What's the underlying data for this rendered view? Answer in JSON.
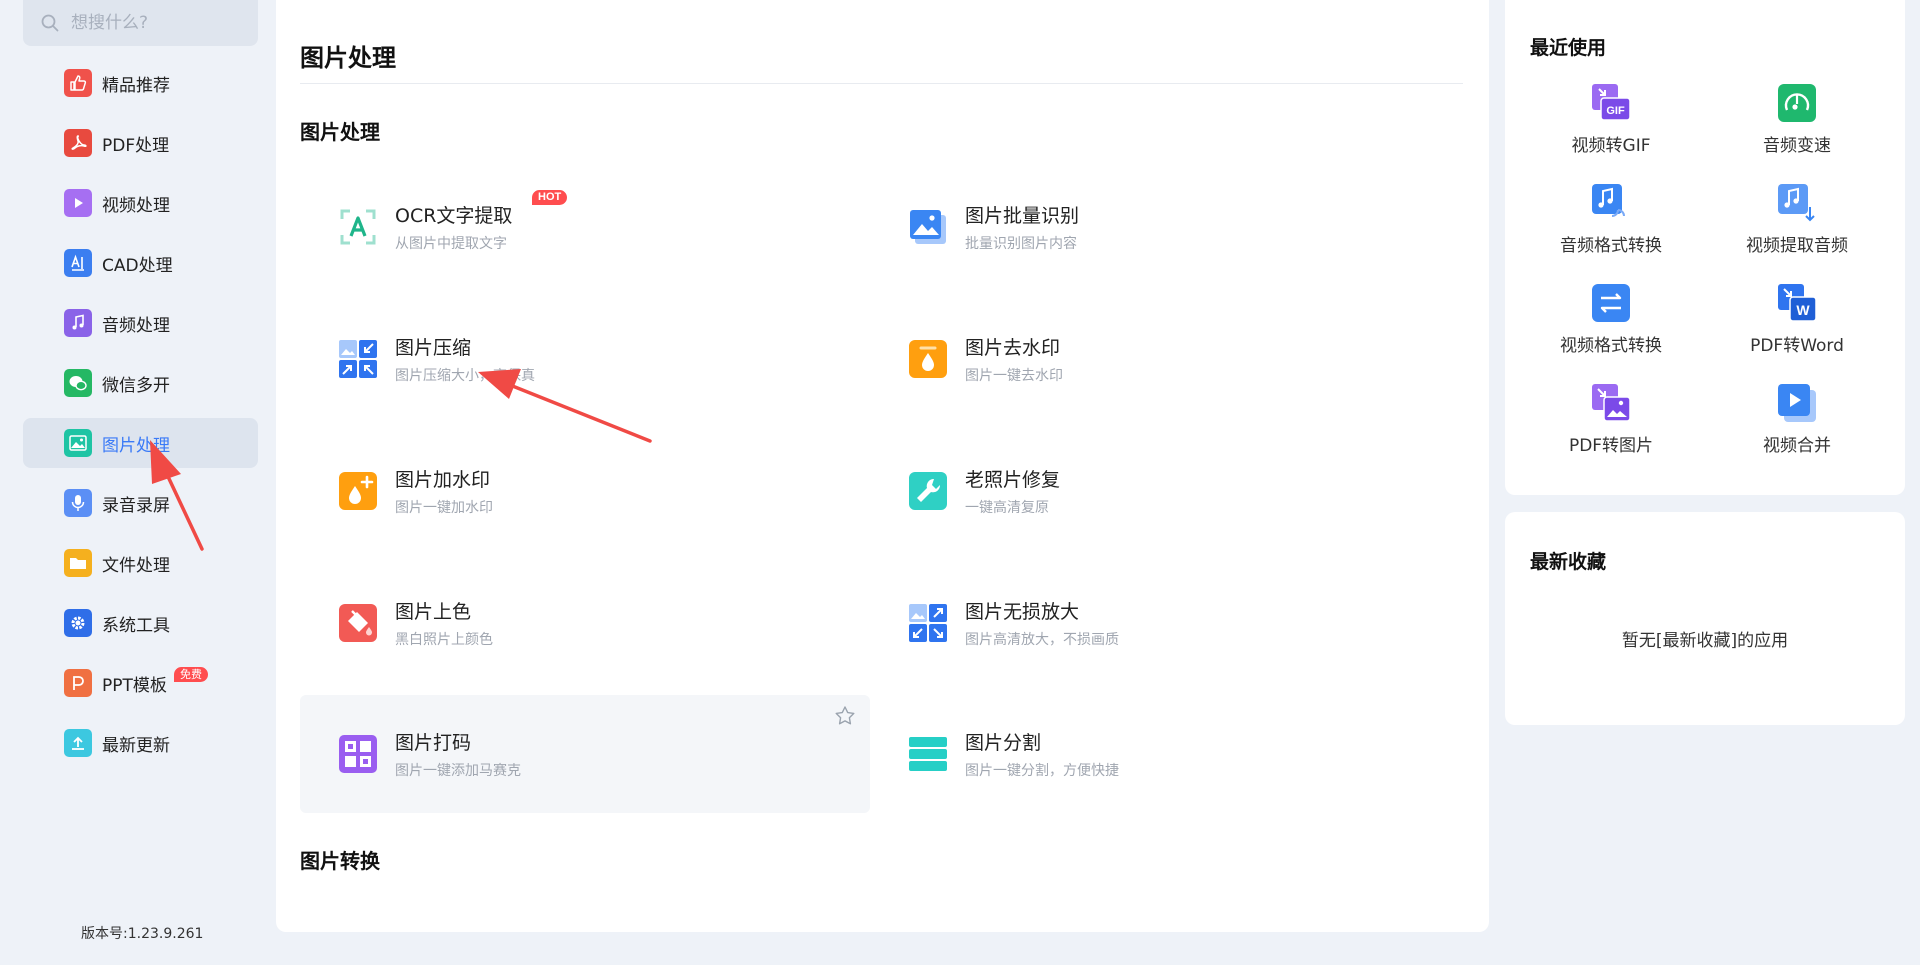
{
  "search": {
    "placeholder": "想搜什么?"
  },
  "sidebar": {
    "items": [
      {
        "label": "精品推荐",
        "icon": "thumbs-up-icon",
        "color": "#f0524b"
      },
      {
        "label": "PDF处理",
        "icon": "pdf-icon",
        "color": "#e84a3f"
      },
      {
        "label": "视频处理",
        "icon": "play-icon",
        "color": "#a66ff2"
      },
      {
        "label": "CAD处理",
        "icon": "cad-icon",
        "color": "#3b7ef0"
      },
      {
        "label": "音频处理",
        "icon": "music-note-icon",
        "color": "#8a63e8"
      },
      {
        "label": "微信多开",
        "icon": "wechat-icon",
        "color": "#25b864"
      },
      {
        "label": "图片处理",
        "icon": "image-icon",
        "color": "#1ec4a4",
        "active": true
      },
      {
        "label": "录音录屏",
        "icon": "microphone-icon",
        "color": "#5b8ff5"
      },
      {
        "label": "文件处理",
        "icon": "folder-icon",
        "color": "#f5b01e"
      },
      {
        "label": "系统工具",
        "icon": "gear-icon",
        "color": "#2f6ee8"
      },
      {
        "label": "PPT模板",
        "icon": "ppt-icon",
        "color": "#f07042",
        "badge": "免费"
      },
      {
        "label": "最新更新",
        "icon": "upload-icon",
        "color": "#3cc8e0"
      }
    ],
    "version": "版本号:1.23.9.261"
  },
  "main": {
    "title": "图片处理",
    "sections": [
      {
        "title": "图片处理"
      },
      {
        "title": "图片转换"
      }
    ],
    "tools": [
      {
        "name": "OCR文字提取",
        "desc": "从图片中提取文字",
        "icon": "ocr-icon",
        "badge": "HOT"
      },
      {
        "name": "图片批量识别",
        "desc": "批量识别图片内容",
        "icon": "image-stack-icon"
      },
      {
        "name": "图片压缩",
        "desc": "图片压缩大小，高保真",
        "icon": "compress-icon"
      },
      {
        "name": "图片去水印",
        "desc": "图片一键去水印",
        "icon": "watermark-remove-icon"
      },
      {
        "name": "图片加水印",
        "desc": "图片一键加水印",
        "icon": "watermark-add-icon"
      },
      {
        "name": "老照片修复",
        "desc": "一键高清复原",
        "icon": "repair-icon"
      },
      {
        "name": "图片上色",
        "desc": "黑白照片上颜色",
        "icon": "paint-bucket-icon"
      },
      {
        "name": "图片无损放大",
        "desc": "图片高清放大，不损画质",
        "icon": "enlarge-icon"
      },
      {
        "name": "图片打码",
        "desc": "图片一键添加马赛克",
        "icon": "mosaic-icon"
      },
      {
        "name": "图片分割",
        "desc": "图片一键分割，方便快捷",
        "icon": "split-icon"
      }
    ]
  },
  "recent": {
    "title": "最近使用",
    "items": [
      {
        "label": "视频转GIF",
        "icon": "gif-icon"
      },
      {
        "label": "音频变速",
        "icon": "speed-icon"
      },
      {
        "label": "音频格式转换",
        "icon": "audio-convert-icon"
      },
      {
        "label": "视频提取音频",
        "icon": "audio-extract-icon"
      },
      {
        "label": "视频格式转换",
        "icon": "video-convert-icon"
      },
      {
        "label": "PDF转Word",
        "icon": "word-icon"
      },
      {
        "label": "PDF转图片",
        "icon": "pdf-to-image-icon"
      },
      {
        "label": "视频合并",
        "icon": "video-merge-icon"
      }
    ]
  },
  "favorites": {
    "title": "最新收藏",
    "empty": "暂无[最新收藏]的应用"
  },
  "colors": {
    "accent": "#3a7af7",
    "background": "#eef2f8",
    "hot": "#ff4d4f",
    "arrow": "#f04a45"
  }
}
